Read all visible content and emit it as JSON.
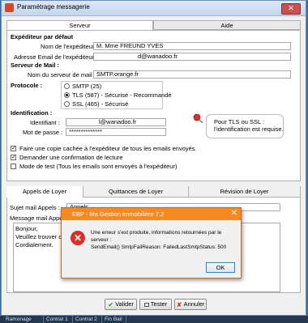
{
  "window": {
    "title": "Paramétrage messagerie",
    "close_glyph": "✕"
  },
  "tabs": [
    {
      "label": "Serveur"
    },
    {
      "label": "Aide"
    }
  ],
  "expediteur": {
    "header": "Expéditeur par défaut",
    "name_label": "Nom de l'expéditeur :",
    "name_value": "M. Mme FREUND YVES",
    "email_label": "Adresse Email de l'expéditeur :",
    "email_value": "d@wanadoo.fr"
  },
  "serveur": {
    "header": "Serveur de Mail :",
    "server_label": "Nom du serveur de mail :",
    "server_value": "SMTP.orange.fr"
  },
  "protocole": {
    "label": "Protocole :",
    "options": [
      {
        "label": "SMTP (25)",
        "selected": false
      },
      {
        "label": "TLS (587) - Sécurisé - Recommandé",
        "selected": true
      },
      {
        "label": "SSL (465) - Sécurisé",
        "selected": false
      }
    ]
  },
  "identification": {
    "header": "Identification :",
    "id_label": "Identifiant :",
    "id_value": "l@wanadoo.fr",
    "pwd_label": "Mot de passe :",
    "pwd_value": "**************",
    "hint": "Pour TLS ou SSL : l'identification est requise."
  },
  "options": [
    {
      "label": "Faire une copie cachée à l'expéditeur de tous les emails envoyés.",
      "checked": true
    },
    {
      "label": "Demander une confirmation de lecture",
      "checked": true
    },
    {
      "label": "Mode de test (Tous les emails sont envoyés à l'expéditeur)",
      "checked": false
    }
  ],
  "bottom_tabs": [
    {
      "label": "Appels de Loyer"
    },
    {
      "label": "Quittances de Loyer"
    },
    {
      "label": "Révision de Loyer"
    }
  ],
  "sujet": {
    "label": "Sujet mail Appels :",
    "value": "Appels"
  },
  "message": {
    "label": "Message mail Appe",
    "lines": [
      "Bonjour,",
      "Veuillez trouver ci-",
      "Cordialement."
    ]
  },
  "buttons": {
    "valider": "Valider",
    "tester": "Tester",
    "annuler": "Annuler"
  },
  "taskbar": [
    "Ramonage",
    "Contrat 1",
    "Contrat 2",
    "Fin Bail"
  ],
  "dialog": {
    "title": "EBP - Ma Gestion Immobilière 7.2",
    "line1": "Une erreur s'est produite, informations retournées par le",
    "line2": "serveur :",
    "line3": "SendEmail() SmtpFailReason: FailedLastSmtpStatus: 500",
    "ok": "OK",
    "close_glyph": "✕"
  },
  "colors": {
    "accent_orange": "#f58a21",
    "error_red": "#d9302b",
    "window_bg": "#f0f0f0"
  }
}
